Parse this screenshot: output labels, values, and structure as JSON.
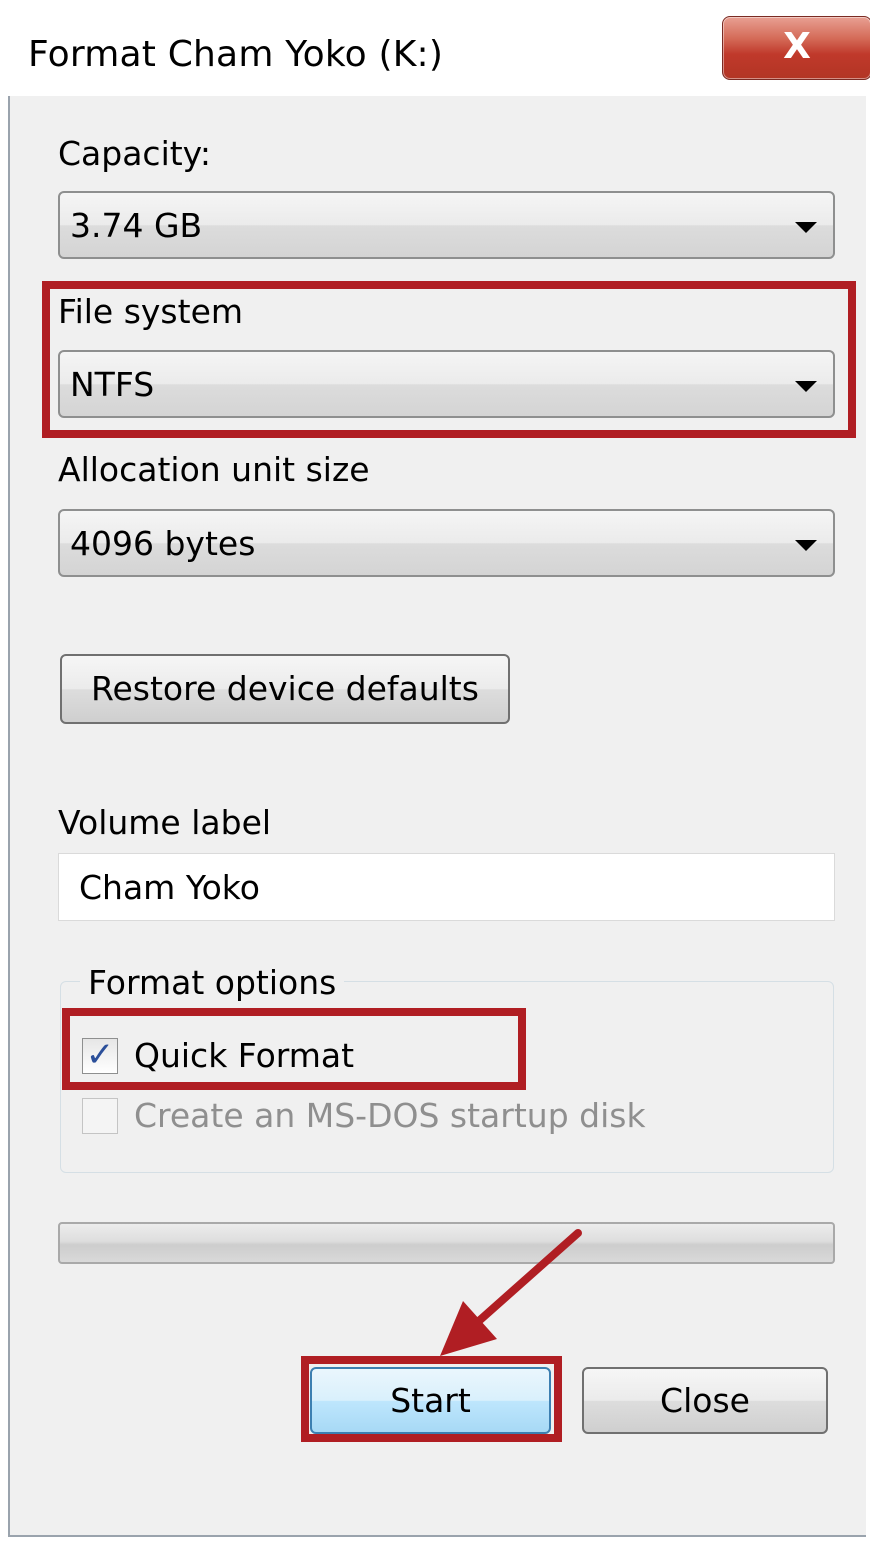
{
  "window": {
    "title": "Format Cham Yoko (K:)",
    "close_glyph": "X"
  },
  "capacity": {
    "label": "Capacity:",
    "value": "3.74 GB"
  },
  "file_system": {
    "label": "File system",
    "value": "NTFS"
  },
  "allocation": {
    "label": "Allocation unit size",
    "value": "4096 bytes"
  },
  "restore_button": {
    "label": "Restore device defaults"
  },
  "volume": {
    "label": "Volume label",
    "value": "Cham Yoko"
  },
  "format_options": {
    "title": "Format options",
    "quick_format": {
      "label": "Quick Format",
      "checked": true
    },
    "msdos": {
      "label": "Create an MS-DOS startup disk",
      "checked": false,
      "enabled": false
    }
  },
  "progress": {
    "value": 0
  },
  "buttons": {
    "start": "Start",
    "close": "Close"
  },
  "annotation": {
    "color": "#b01e23"
  },
  "icons": {
    "dropdown": "chevron-down-icon",
    "check": "checkmark-icon",
    "close": "close-icon"
  }
}
